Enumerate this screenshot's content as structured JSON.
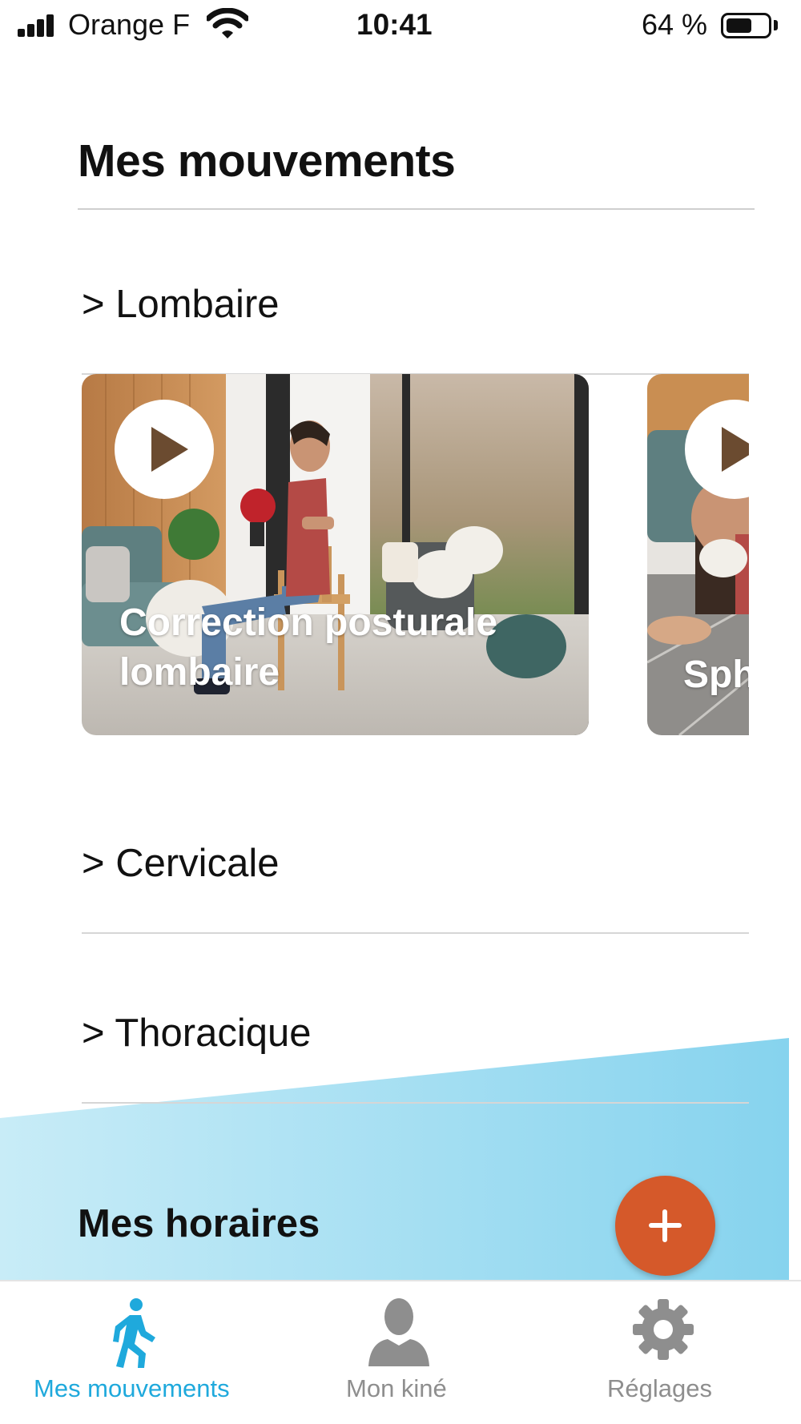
{
  "status_bar": {
    "carrier": "Orange F",
    "time": "10:41",
    "battery_percent_label": "64 %",
    "battery_level": 0.64
  },
  "header": {
    "title": "Mes mouvements"
  },
  "sections": [
    {
      "label": "> Lombaire",
      "videos": [
        {
          "title_line1": "Correction posturale",
          "title_line2": "lombaire",
          "icon": "play-icon"
        },
        {
          "title_partial": "Sph",
          "icon": "play-icon"
        }
      ]
    },
    {
      "label": "> Cervicale"
    },
    {
      "label": "> Thoracique"
    }
  ],
  "schedule": {
    "title": "Mes horaires",
    "add_icon": "plus-icon"
  },
  "tabs": [
    {
      "label": "Mes mouvements",
      "icon": "walking-person-icon",
      "active": true
    },
    {
      "label": "Mon kiné",
      "icon": "person-icon",
      "active": false
    },
    {
      "label": "Réglages",
      "icon": "gear-icon",
      "active": false
    }
  ],
  "colors": {
    "accent": "#1fa9dc",
    "fab": "#d5592a",
    "band_start": "#c8ecf7",
    "band_end": "#86d3ee",
    "inactive_tab": "#8e8e8e"
  }
}
